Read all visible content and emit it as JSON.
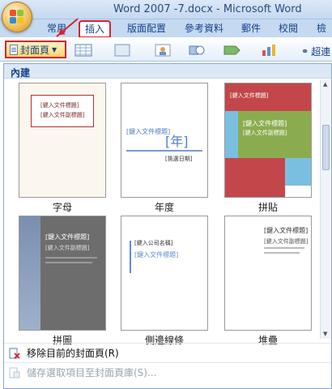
{
  "window": {
    "title": "Word 2007 -7.docx - Microsoft Word"
  },
  "tabs": [
    {
      "label": "常用"
    },
    {
      "label": "插入"
    },
    {
      "label": "版面配置"
    },
    {
      "label": "參考資料"
    },
    {
      "label": "郵件"
    },
    {
      "label": "校閱"
    },
    {
      "label": "檢"
    }
  ],
  "ribbon": {
    "cover_page_label": "封面頁",
    "link_label": "超連"
  },
  "gallery": {
    "header": "內建",
    "templates": [
      {
        "caption": "字母",
        "title": "[鍵入文件標題]",
        "subtitle": "[鍵入文件副標題]"
      },
      {
        "caption": "年度",
        "title": "[鍵入文件標題]",
        "year": "[年]",
        "small": "[挑選日期]"
      },
      {
        "caption": "拼貼",
        "title": "[鍵入文件標題]",
        "subtitle": "[鍵入文件副標題]"
      },
      {
        "caption": "拼圖",
        "title": "[鍵入文件標題]",
        "subtitle": "[鍵入文件副標題]"
      },
      {
        "caption": "側邊線條",
        "title": "[鍵入文件標題]",
        "small": "[鍵入公司名稱]"
      },
      {
        "caption": "堆疊",
        "title": "[鍵入文件標題]",
        "subtitle": "[鍵入文件副標題]"
      }
    ]
  },
  "menu": {
    "remove_label": "移除目前的封面頁(R)",
    "save_label": "儲存選取項目至封面頁庫(S)..."
  },
  "colors": {
    "accent_red": "#d6252b",
    "ribbon_blue": "#15428b",
    "tile_green": "#8bac4e",
    "tile_red": "#c3474a",
    "tile_blue": "#7bbfe0"
  }
}
